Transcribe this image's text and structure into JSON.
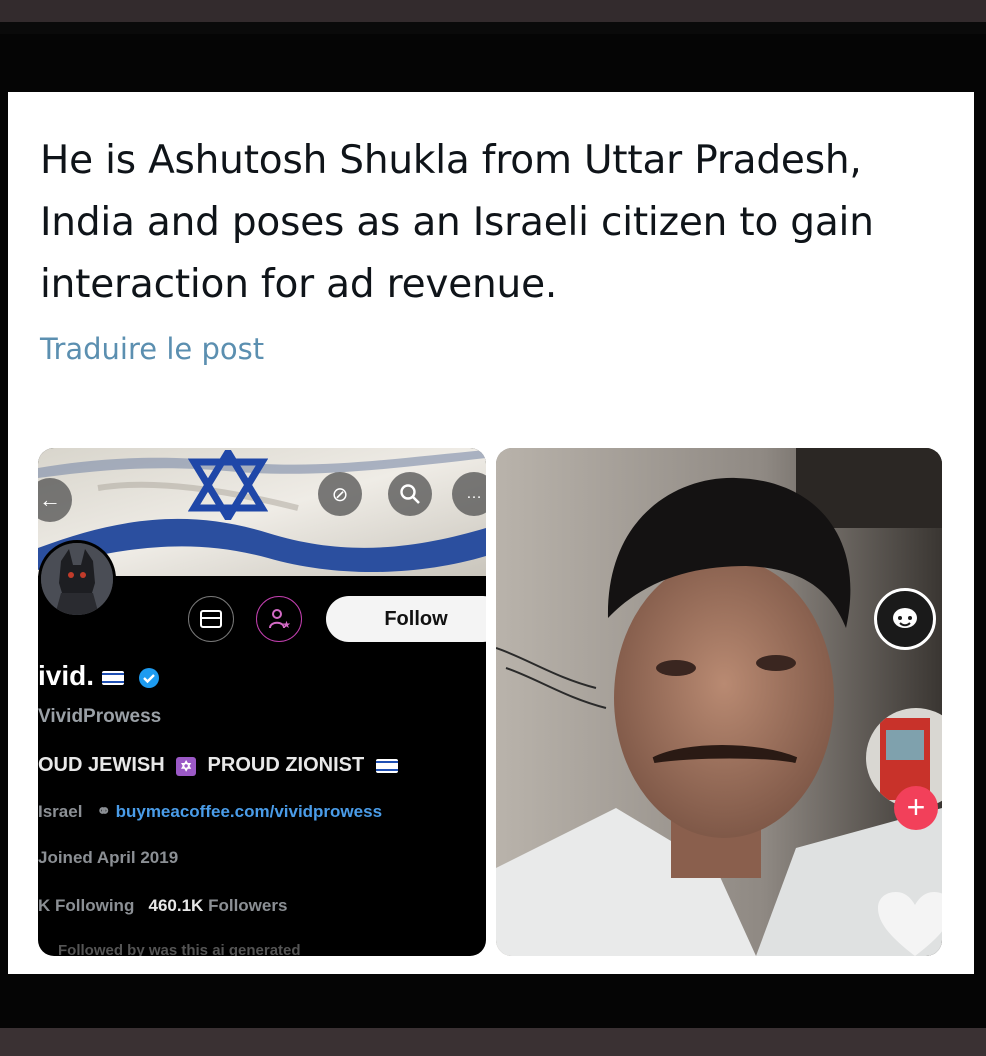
{
  "tweet": {
    "text": "He is Ashutosh Shukla from Uttar Pradesh, India and poses as an Israeli citizen to gain interaction for ad revenue.",
    "translate_label": "Traduire le post"
  },
  "profile": {
    "follow_label": "Follow",
    "name": "ivid.",
    "handle": "VividProwess",
    "bio_part1": "OUD JEWISH",
    "bio_part2": "PROUD ZIONIST",
    "location": "Israel",
    "link": "buymeacoffee.com/vividprowess",
    "joined": "Joined April 2019",
    "following_count": "K",
    "following_label": "Following",
    "followers_count": "460.1K",
    "followers_label": "Followers",
    "followed_by_cut": "Followed by was this ai generated"
  },
  "colors": {
    "link": "#5b8fb0",
    "verified": "#1d9bf0",
    "like_red": "#f2405a"
  },
  "icons": [
    "back-arrow-icon",
    "refresh-icon",
    "search-icon",
    "more-icon",
    "mail-icon",
    "person-star-icon",
    "verified-badge-icon",
    "star-of-david-icon",
    "link-icon",
    "comment-icon",
    "plus-icon",
    "heart-icon"
  ]
}
